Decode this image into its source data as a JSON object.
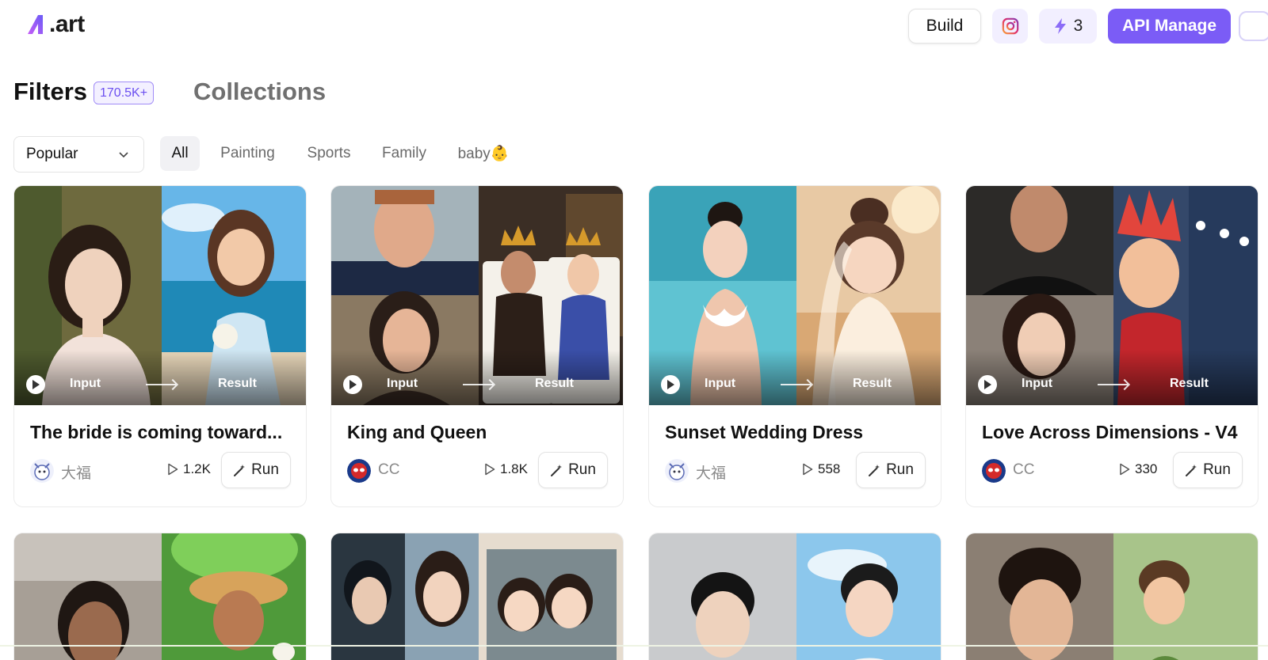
{
  "header": {
    "logo_text": ".art",
    "build_label": "Build",
    "instagram_icon": "instagram-icon",
    "credits_icon": "lightning-icon",
    "credits_count": "3",
    "api_label": "API Manage"
  },
  "sections": {
    "filters_label": "Filters",
    "filters_count": "170.5K+",
    "collections_label": "Collections"
  },
  "filter_bar": {
    "sort_value": "Popular",
    "chips": [
      "All",
      "Painting",
      "Sports",
      "Family",
      "baby👶"
    ]
  },
  "card_labels": {
    "input": "Input",
    "result": "Result",
    "run": "Run"
  },
  "cards": [
    {
      "title": "The bride is coming toward...",
      "author": "大福",
      "runs": "1.2K"
    },
    {
      "title": "King and Queen",
      "author": "CC",
      "runs": "1.8K"
    },
    {
      "title": "Sunset Wedding Dress",
      "author": "大福",
      "runs": "558"
    },
    {
      "title": "Love Across Dimensions - V4",
      "author": "CC",
      "runs": "330"
    }
  ],
  "colors": {
    "accent": "#7b5cf6",
    "accent_soft": "#f2efff",
    "chip_active_bg": "#f1f1f4"
  }
}
